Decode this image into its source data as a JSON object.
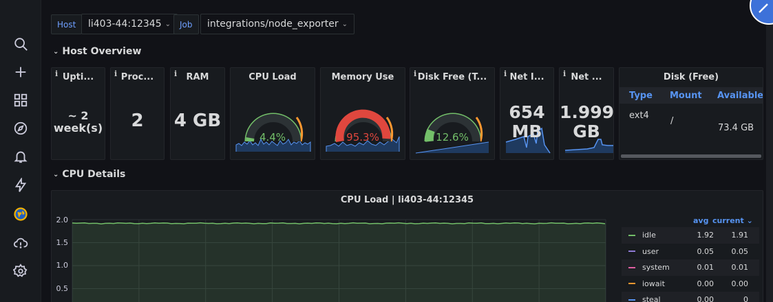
{
  "variables": {
    "host_label": "Host",
    "host_value": "li403-44:12345",
    "job_label": "Job",
    "job_value": "integrations/node_exporter"
  },
  "rows": {
    "host_overview": "Host Overview",
    "cpu_details": "CPU Details"
  },
  "panels": {
    "uptime": {
      "title": "Upti...",
      "value_line1": "~ 2",
      "value_line2": "week(s)"
    },
    "processors": {
      "title": "Proc...",
      "value": "2"
    },
    "ram": {
      "title": "RAM",
      "value": "4 GB"
    },
    "cpu_load": {
      "title": "CPU Load",
      "value": "4.4%",
      "percent": 4.4
    },
    "memory_use": {
      "title": "Memory Use",
      "value": "95.3%",
      "percent": 95.3
    },
    "disk_free": {
      "title": "Disk Free (T...",
      "value": "12.6%",
      "percent": 12.6
    },
    "net_in": {
      "title": "Net I...",
      "value_line1": "654",
      "value_line2": "MB"
    },
    "net_out": {
      "title": "Net ...",
      "value_line1": "1.999",
      "value_line2": "GB"
    },
    "disk_table": {
      "title": "Disk (Free)",
      "columns": [
        "Type",
        "Mount",
        "Available"
      ],
      "rows": [
        {
          "type": "ext4",
          "mount": "/",
          "available": "73.4 GB"
        }
      ]
    }
  },
  "cpu_graph": {
    "title": "CPU Load | li403-44:12345",
    "legend_avg": "avg",
    "legend_current": "current",
    "series": [
      {
        "name": "idle",
        "avg": "1.92",
        "current": "1.91",
        "color": "#73bf69"
      },
      {
        "name": "user",
        "avg": "0.05",
        "current": "0.05",
        "color": "#8f7bd6"
      },
      {
        "name": "system",
        "avg": "0.01",
        "current": "0.01",
        "color": "#e05fa2"
      },
      {
        "name": "iowait",
        "avg": "0.00",
        "current": "0.00",
        "color": "#ff9830"
      },
      {
        "name": "steal",
        "avg": "0.00",
        "current": "0",
        "color": "#5794f2"
      }
    ]
  },
  "chart_data": {
    "type": "line",
    "title": "CPU Load | li403-44:12345",
    "y_ticks": [
      "2.0",
      "1.5",
      "1.0",
      "0.5"
    ],
    "ylim": [
      0,
      2
    ],
    "series": [
      {
        "name": "idle",
        "value": 1.92
      }
    ]
  },
  "colors": {
    "accent": "#5794f2",
    "green": "#73bf69",
    "red": "#e0473e",
    "orange": "#ff9830",
    "blue": "#3d71d9"
  }
}
